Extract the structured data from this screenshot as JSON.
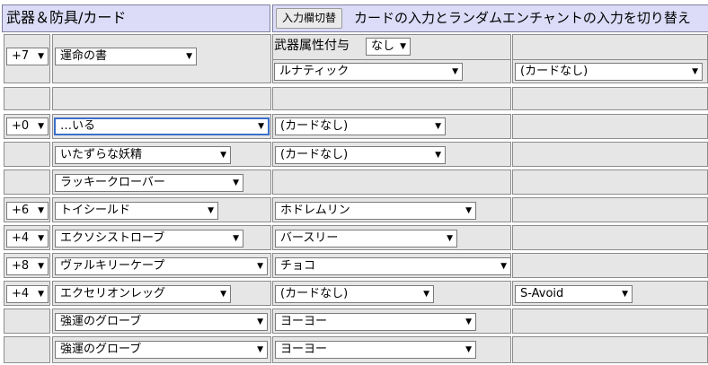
{
  "header": {
    "title": "武器＆防具/カード",
    "toggle_button": "入力欄切替",
    "description": "カードの入力とランダムエンチャントの入力を切り替え"
  },
  "weapon": {
    "refine": "+7",
    "name": "運命の書",
    "attribute_label": "武器属性付与",
    "attribute_value": "なし",
    "card1": "ルナティック",
    "card2": "(カードなし)"
  },
  "equipment_rows": [
    {
      "refine": "+0",
      "item": "…いる",
      "card": "(カードなし)",
      "extra": ""
    },
    {
      "refine": "",
      "item": "いたずらな妖精",
      "card": "(カードなし)",
      "extra": ""
    },
    {
      "refine": "",
      "item": "ラッキークローバー",
      "card": "",
      "extra": ""
    },
    {
      "refine": "+6",
      "item": "トイシールド",
      "card": "ホドレムリン",
      "extra": ""
    },
    {
      "refine": "+4",
      "item": "エクソシストローブ",
      "card": "バースリー",
      "extra": ""
    },
    {
      "refine": "+8",
      "item": "ヴァルキリーケープ",
      "card": "チョコ",
      "extra": ""
    },
    {
      "refine": "+4",
      "item": "エクセリオンレッグ",
      "card": "(カードなし)",
      "extra": "S-Avoid"
    },
    {
      "refine": "",
      "item": "強運のグローブ",
      "card": "ヨーヨー",
      "extra": ""
    },
    {
      "refine": "",
      "item": "強運のグローブ",
      "card": "ヨーヨー",
      "extra": ""
    }
  ]
}
